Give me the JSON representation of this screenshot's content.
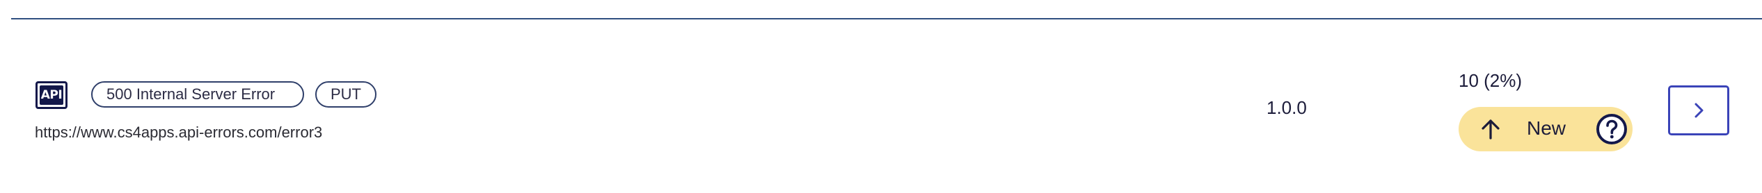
{
  "error_row": {
    "type_badge": "API",
    "status_tag": "500 Internal Server Error",
    "method_tag": "PUT",
    "url": "https://www.cs4apps.api-errors.com/error3",
    "version": "1.0.0",
    "count": "10 (2%)",
    "trend": {
      "label": "New",
      "icon": "arrow-up-icon",
      "help_icon": "question-circle-icon"
    },
    "open_button_icon": "chevron-right-icon"
  },
  "colors": {
    "divider": "#2f4f80",
    "badge_dark": "#13184a",
    "trend_bg": "#fae39a",
    "button_accent": "#3a43b8"
  }
}
